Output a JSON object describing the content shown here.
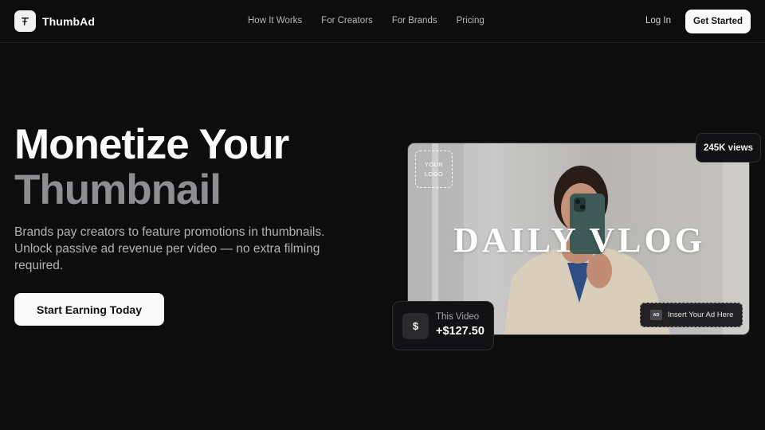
{
  "brand": {
    "name": "ThumbAd"
  },
  "nav": {
    "links": [
      "How It Works",
      "For Creators",
      "For Brands",
      "Pricing"
    ],
    "login": "Log In",
    "cta": "Get Started"
  },
  "hero": {
    "headline_line1": "Monetize Your",
    "headline_line2": "Thumbnail",
    "subcopy": "Brands pay creators to feature promotions in thumbnails. Unlock passive ad revenue per video — no extra filming required.",
    "cta": "Start Earning Today"
  },
  "thumbnail": {
    "logo_line1": "YOUR",
    "logo_line2": "LOGO",
    "title": "DAILY VLOG",
    "ad_tag": "AD",
    "ad_text": "Insert Your Ad Here"
  },
  "stats": {
    "views": "245K views",
    "earn_icon": "$",
    "earn_label": "This Video",
    "earn_value": "+$127.50"
  },
  "colors": {
    "background": "#0d0d0e",
    "headline_muted": "#8e8e92",
    "button": "#fafafa"
  }
}
